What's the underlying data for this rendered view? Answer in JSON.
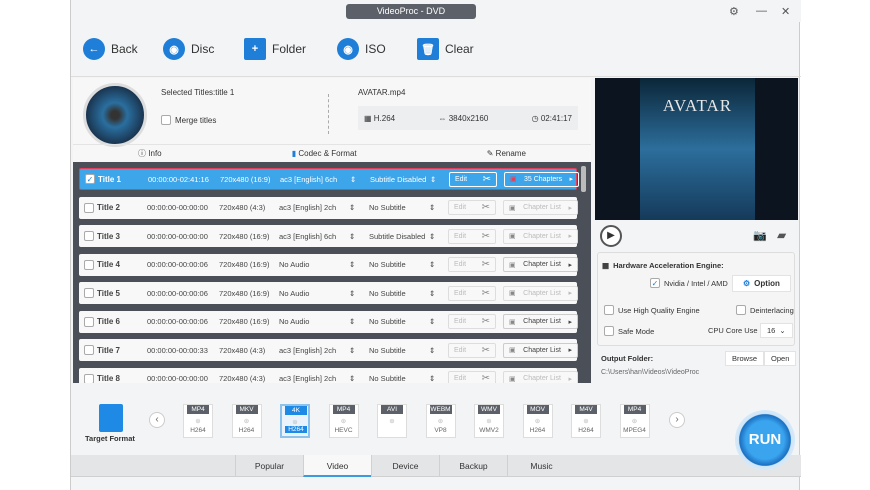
{
  "window": {
    "title": "VideoProc - DVD"
  },
  "toolbar": {
    "back": "Back",
    "disc": "Disc",
    "folder": "Folder",
    "iso": "ISO",
    "clear": "Clear"
  },
  "info": {
    "selected": "Selected Titles:title 1",
    "merge": "Merge titles",
    "filename": "AVATAR.mp4",
    "codec": "H.264",
    "resolution": "3840x2160",
    "duration": "02:41:17",
    "tabs": [
      "Info",
      "Codec & Format",
      "Rename"
    ]
  },
  "titles": [
    {
      "name": "Title 1",
      "time": "00:00:00-02:41:16",
      "res": "720x480 (16:9)",
      "audio": "ac3 [English] 6ch",
      "sub": "Subtitle Disabled",
      "edit": "Edit",
      "chapters": "35 Chapters",
      "checked": true
    },
    {
      "name": "Title 2",
      "time": "00:00:00-00:00:00",
      "res": "720x480 (4:3)",
      "audio": "ac3 [English] 2ch",
      "sub": "No Subtitle",
      "edit": "Edit",
      "chapters": "Chapter List",
      "checked": false
    },
    {
      "name": "Title 3",
      "time": "00:00:00-00:00:00",
      "res": "720x480 (16:9)",
      "audio": "ac3 [English] 6ch",
      "sub": "Subtitle Disabled",
      "edit": "Edit",
      "chapters": "Chapter List",
      "checked": false
    },
    {
      "name": "Title 4",
      "time": "00:00:00-00:00:06",
      "res": "720x480 (16:9)",
      "audio": "No Audio",
      "sub": "No Subtitle",
      "edit": "Edit",
      "chapters": "Chapter List",
      "checked": false
    },
    {
      "name": "Title 5",
      "time": "00:00:00-00:00:06",
      "res": "720x480 (16:9)",
      "audio": "No Audio",
      "sub": "No Subtitle",
      "edit": "Edit",
      "chapters": "Chapter List",
      "checked": false
    },
    {
      "name": "Title 6",
      "time": "00:00:00-00:00:06",
      "res": "720x480 (16:9)",
      "audio": "No Audio",
      "sub": "No Subtitle",
      "edit": "Edit",
      "chapters": "Chapter List",
      "checked": false
    },
    {
      "name": "Title 7",
      "time": "00:00:00-00:00:33",
      "res": "720x480 (4:3)",
      "audio": "ac3 [English] 2ch",
      "sub": "No Subtitle",
      "edit": "Edit",
      "chapters": "Chapter List",
      "checked": false
    },
    {
      "name": "Title 8",
      "time": "00:00:00-00:00:00",
      "res": "720x480 (4:3)",
      "audio": "ac3 [English] 2ch",
      "sub": "No Subtitle",
      "edit": "Edit",
      "chapters": "Chapter List",
      "checked": false
    }
  ],
  "preview": {
    "poster_text": "AVATAR"
  },
  "settings": {
    "hw_title": "Hardware Acceleration Engine:",
    "hw_option": "Nvidia / Intel / AMD",
    "option_btn": "Option",
    "hq": "Use High Quality Engine",
    "deinterlace": "Deinterlacing",
    "safe": "Safe Mode",
    "cpu_label": "CPU Core Use",
    "cpu_value": "16",
    "output_label": "Output Folder:",
    "browse": "Browse",
    "open": "Open",
    "output_path": "C:\\Users\\han\\Videos\\VideoProc"
  },
  "formats": {
    "target_label": "Target Format",
    "items": [
      {
        "tag": "MP4",
        "sub": "H264"
      },
      {
        "tag": "MKV",
        "sub": "H264"
      },
      {
        "tag": "4K",
        "sub": "H264",
        "active": true
      },
      {
        "tag": "MP4",
        "sub": "HEVC"
      },
      {
        "tag": "AVI",
        "sub": ""
      },
      {
        "tag": "WEBM",
        "sub": "VP8"
      },
      {
        "tag": "WMV",
        "sub": "WMV2"
      },
      {
        "tag": "MOV",
        "sub": "H264"
      },
      {
        "tag": "M4V",
        "sub": "H264"
      },
      {
        "tag": "MP4",
        "sub": "MPEG4"
      }
    ]
  },
  "tabs": [
    "Popular",
    "Video",
    "Device",
    "Backup",
    "Music"
  ],
  "active_tab": "Video",
  "run": "RUN",
  "colors": {
    "accent": "#1f7fd8",
    "selected_row": "#3da5ea",
    "list_bg": "#4b5058"
  }
}
